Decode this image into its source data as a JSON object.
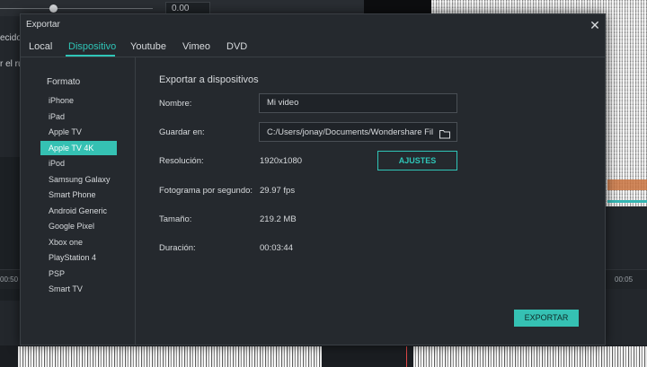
{
  "background": {
    "time_display": "0.00",
    "left_text_1": "ecido",
    "left_text_2": "r el ru",
    "ruler_left": "00:50",
    "ruler_right": "00:05"
  },
  "dialog": {
    "title": "Exportar",
    "close_icon": "close-icon",
    "tabs": [
      {
        "label": "Local",
        "active": false
      },
      {
        "label": "Dispositivo",
        "active": true
      },
      {
        "label": "Youtube",
        "active": false
      },
      {
        "label": "Vimeo",
        "active": false
      },
      {
        "label": "DVD",
        "active": false
      }
    ],
    "sidebar": {
      "heading": "Formato",
      "items": [
        {
          "label": "iPhone",
          "selected": false
        },
        {
          "label": "iPad",
          "selected": false
        },
        {
          "label": "Apple TV",
          "selected": false
        },
        {
          "label": "Apple TV 4K",
          "selected": true
        },
        {
          "label": "iPod",
          "selected": false
        },
        {
          "label": "Samsung Galaxy",
          "selected": false
        },
        {
          "label": "Smart Phone",
          "selected": false
        },
        {
          "label": "Android Generic",
          "selected": false
        },
        {
          "label": "Google Pixel",
          "selected": false
        },
        {
          "label": "Xbox one",
          "selected": false
        },
        {
          "label": "PlayStation 4",
          "selected": false
        },
        {
          "label": "PSP",
          "selected": false
        },
        {
          "label": "Smart TV",
          "selected": false
        }
      ]
    },
    "main": {
      "heading": "Exportar a dispositivos",
      "name_label": "Nombre:",
      "name_value": "Mi video",
      "save_label": "Guardar en:",
      "save_value": "C:/Users/jonay/Documents/Wondershare Fil",
      "folder_icon": "folder-icon",
      "resolution_label": "Resolución:",
      "resolution_value": "1920x1080",
      "settings_button": "AJUSTES",
      "fps_label": "Fotograma por segundo:",
      "fps_value": "29.97 fps",
      "size_label": "Tamaño:",
      "size_value": "219.2 MB",
      "duration_label": "Duración:",
      "duration_value": "00:03:44",
      "export_button": "EXPORTAR"
    }
  },
  "colors": {
    "accent": "#35c1b3",
    "dialog_bg": "#25292e",
    "text": "#d7dadd"
  }
}
